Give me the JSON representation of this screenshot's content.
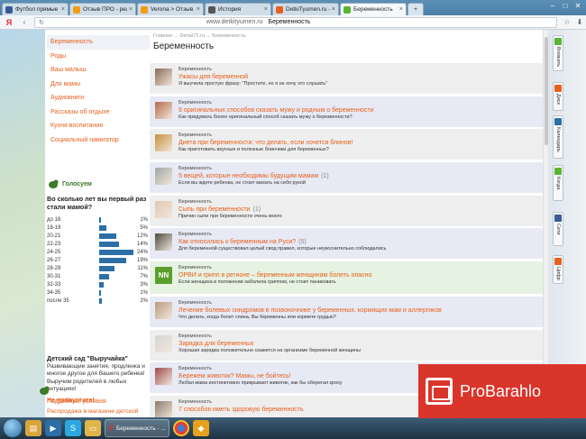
{
  "browser": {
    "tabs": [
      {
        "label": "Футбол прямые тран",
        "color": "#3b5998",
        "active": false
      },
      {
        "label": "Отзыв ПРО - реальн",
        "color": "#f39c12",
        "active": false
      },
      {
        "label": "Verona > Отзыв ПРО",
        "color": "#f39c12",
        "active": false
      },
      {
        "label": "История",
        "color": "#555555",
        "active": false
      },
      {
        "label": "DetkiTyumen.ru - тюм",
        "color": "#e8601c",
        "active": false
      },
      {
        "label": "Беременность",
        "color": "#5bb531",
        "active": true
      }
    ],
    "address_logo": "Я",
    "domain": "www.detkityumen.ru",
    "page_title": "Беременность"
  },
  "sidebar": {
    "items": [
      {
        "label": "Беременность",
        "active": true
      },
      {
        "label": "Роды"
      },
      {
        "label": "Ваш малыш"
      },
      {
        "label": "Для мамы"
      },
      {
        "label": "Аудиокниги"
      },
      {
        "label": "Рассказы об отдыхе"
      },
      {
        "label": "Кухня воспитания"
      },
      {
        "label": "Социальный навигатор"
      }
    ]
  },
  "poll": {
    "header": "Голосуем",
    "question": "Во сколько лет вы первый раз стали мамой?",
    "rows": [
      {
        "label": "до 18",
        "pct": "1%",
        "value": 1
      },
      {
        "label": "18-19",
        "pct": "5%",
        "value": 5
      },
      {
        "label": "20-21",
        "pct": "12%",
        "value": 12
      },
      {
        "label": "22-23",
        "pct": "14%",
        "value": 14
      },
      {
        "label": "24-25",
        "pct": "24%",
        "value": 24
      },
      {
        "label": "26-27",
        "pct": "19%",
        "value": 19
      },
      {
        "label": "28-29",
        "pct": "11%",
        "value": 11
      },
      {
        "label": "30-31",
        "pct": "7%",
        "value": 7
      },
      {
        "label": "32-33",
        "pct": "3%",
        "value": 3
      },
      {
        "label": "34-35",
        "pct": "1%",
        "value": 1
      },
      {
        "label": "после 35",
        "pct": "2%",
        "value": 2
      }
    ]
  },
  "kinder": {
    "title": "Детский сад \"Выручайка\"",
    "text": "Развивающие занятия, продленка и многое другое для Вашего ребенка! Выручим родителей в любых ситуациях!",
    "link": "Подробные условия"
  },
  "dontmiss": {
    "title": "Не пропустите!",
    "link": "Распродажа в магазине детской"
  },
  "main": {
    "breadcrumb": "Главная → Dетки72.ru → Беременность",
    "title": "Беременность",
    "cards": [
      {
        "cat": "Беременность",
        "title": "Ужасы для беременной",
        "count": "",
        "desc": "Я выучила простую фразу: \"Простите, но я не хочу это слушать\"",
        "thumb": "#8a6a55"
      },
      {
        "cat": "Беременность",
        "title": "9 оригинальных способов сказать мужу и родным о беременности",
        "count": "",
        "desc": "Как придумать более оригинальный способ сказать мужу о беременности?",
        "thumb": "#b56a4a"
      },
      {
        "cat": "Беременность",
        "title": "Диета при беременности: что делать, если хочется блинов!",
        "count": "",
        "desc": "Как приготовить вкусные и полезные блинчики для беременных?",
        "thumb": "#c8903a"
      },
      {
        "cat": "Беременность",
        "title": "5 вещей, которые необходимы будущим мамам",
        "count": "(1)",
        "desc": "Если вы ждете ребенка, не стоит махать на себя рукой",
        "thumb": "#9fa7a0"
      },
      {
        "cat": "Беременность",
        "title": "Сыпь при беременности",
        "count": "(1)",
        "desc": "Причин сыпи при беременности очень много",
        "thumb": "#e0c6b0"
      },
      {
        "cat": "Беременность",
        "title": "Как относились к беременным на Руси?",
        "count": "(5)",
        "desc": "Для беременной существовал целый свод правил, которые неукоснительно соблюдались",
        "thumb": "#4b4a3c"
      },
      {
        "cat": "Беременность",
        "title": "ОРВИ и грипп в регионе – беременным женщинам болеть опасно",
        "count": "",
        "desc": "Если женщина в положении заболела гриппом, не стоит паниковать",
        "thumb": "#5a9f2d",
        "badge": "NN"
      },
      {
        "cat": "Беременность",
        "title": "Лечение болевых синдромов в позвоночнике у беременных, кормящих мам и аллергиков",
        "count": "",
        "desc": "Что делать, когда болит спина, Вы беременны или кормите грудью?",
        "thumb": "#b89a80"
      },
      {
        "cat": "Беременность",
        "title": "Зарядка для беременных",
        "count": "",
        "desc": "Хорошая зарядка положительно скажется на организме беременной женщины",
        "thumb": "#d7d5d3"
      },
      {
        "cat": "Беременность",
        "title": "Бережем животик? Мамы, не бойтесь!",
        "count": "",
        "desc": "Любая мама инстинктивно прикрывает животик, как бы оберегая кроху",
        "thumb": "#a04a4a"
      },
      {
        "cat": "Беременность",
        "title": "7 способов иметь здоровую беременность",
        "count": "",
        "desc": "",
        "thumb": "#8b7a6a"
      }
    ]
  },
  "sidepanel": [
    {
      "label": "Вложить",
      "color": "#5bb531"
    },
    {
      "label": "Диск",
      "color": "#e8601c"
    },
    {
      "label": "Календарь",
      "color": "#2c6fa6"
    },
    {
      "label": "Когда",
      "color": "#5bb531"
    },
    {
      "label": "Сети",
      "color": "#3b5998"
    },
    {
      "label": "Цифр",
      "color": "#e8601c"
    }
  ],
  "taskbar": {
    "active_task": "Беременность - ..."
  },
  "watermark": {
    "text": "ProBarahlo"
  }
}
